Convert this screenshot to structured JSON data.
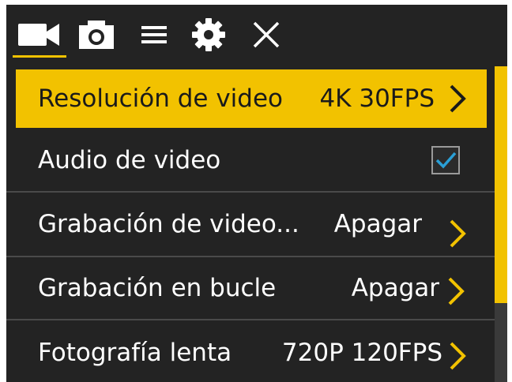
{
  "tabs": [
    {
      "name": "video",
      "icon": "video-camera-icon",
      "active": true
    },
    {
      "name": "photo",
      "icon": "camera-icon",
      "active": false
    },
    {
      "name": "list",
      "icon": "menu-list-icon",
      "active": false
    },
    {
      "name": "settings",
      "icon": "gear-icon",
      "active": false
    },
    {
      "name": "close",
      "icon": "close-icon",
      "active": false
    }
  ],
  "menu": {
    "items": [
      {
        "label": "Resolución de video",
        "value": "4K 30FPS",
        "control": "chevron",
        "selected": true
      },
      {
        "label": "Audio de video",
        "value": "",
        "control": "checkbox",
        "checked": true
      },
      {
        "label": "Grabación de video...",
        "value": "Apagar",
        "control": "chevron"
      },
      {
        "label": "Grabación en bucle",
        "value": "Apagar",
        "control": "chevron"
      },
      {
        "label": "Fotografía lenta",
        "value": "720P 120FPS",
        "control": "chevron"
      }
    ]
  },
  "colors": {
    "accent": "#f2c200",
    "background": "#232323",
    "checkmark": "#2a9fd6"
  }
}
